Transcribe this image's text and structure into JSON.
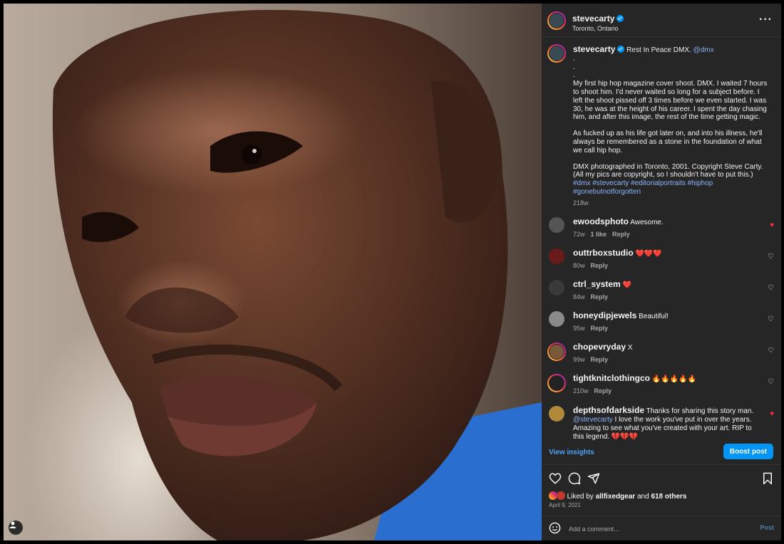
{
  "post": {
    "username": "stevecarty",
    "location": "Toronto, Ontario",
    "caption": {
      "first_line": "Rest In Peace DMX.",
      "mention": "@dmx",
      "dots": [
        ".",
        ".",
        "."
      ],
      "paragraph1": "My first hip hop magazine cover shoot. DMX. I waited 7 hours to shoot him. I'd never waited so long for a subject before. I left the shoot pissed off 3 times before we even started. I was 30, he was at the height of his career. I spent the day chasing him, and after this image, the rest of the time getting magic.",
      "paragraph2": "As fucked up as his life got later on, and into his illness, he'll always be remembered as a stone in the foundation of what we call hip hop.",
      "paragraph3a": "DMX photographed in Toronto, 2001. Copyright Steve Carty.",
      "paragraph3b": "(All my pics are copyright, so I shouldn't have to put this.)",
      "hashtags": "#dmx #stevecarty #editorialportraits #hiphop #gonebutnotforgotten",
      "age": "218w"
    }
  },
  "comments": [
    {
      "user": "ewoodsphoto",
      "text": "Awesome.",
      "age": "72w",
      "likes": "1 like",
      "reply": "Reply",
      "liked": true,
      "color": "#555"
    },
    {
      "user": "outtrboxstudio",
      "text": "❤️❤️❤️",
      "age": "80w",
      "likes": "",
      "reply": "Reply",
      "liked": false,
      "color": "#6b1a1a"
    },
    {
      "user": "ctrl_system",
      "text": "❤️",
      "age": "84w",
      "likes": "",
      "reply": "Reply",
      "liked": false,
      "color": "#3a3a3a"
    },
    {
      "user": "honeydipjewels",
      "text": "Beautiful!",
      "age": "95w",
      "likes": "",
      "reply": "Reply",
      "liked": false,
      "color": "#8a8a8a"
    },
    {
      "user": "chopevryday",
      "text": "X",
      "age": "99w",
      "likes": "",
      "reply": "Reply",
      "liked": false,
      "color": "#7a5a3a"
    },
    {
      "user": "tightknitclothingco",
      "text": "🔥🔥🔥🔥🔥",
      "age": "210w",
      "likes": "",
      "reply": "Reply",
      "liked": false,
      "color": "#222"
    },
    {
      "user": "depthsofdarkside",
      "text": "Thanks for sharing this story man.",
      "mention": "@stevecarty",
      "text2": "I love the work you've put in over the years. Amazing to see what you've created with your art. RIP to this legend. 💔💔💔",
      "age": "",
      "likes": "",
      "reply": "",
      "liked": true,
      "color": "#b08a3a"
    }
  ],
  "actions": {
    "view_insights": "View insights",
    "boost_post": "Boost post",
    "liked_by_prefix": "Liked by",
    "liked_by_user": "allfixedgear",
    "liked_by_and": "and",
    "liked_by_others": "618 others",
    "date": "April 9, 2021"
  },
  "comment_box": {
    "placeholder": "Add a comment...",
    "post_label": "Post"
  },
  "colors": {
    "accent": "#0095f6",
    "like_red": "#ff3040",
    "panel_bg": "#262626"
  },
  "icons": [
    "heart-icon",
    "comment-icon",
    "share-icon",
    "bookmark-icon",
    "more-icon",
    "emoji-icon",
    "verified-icon",
    "user-tag-icon"
  ]
}
